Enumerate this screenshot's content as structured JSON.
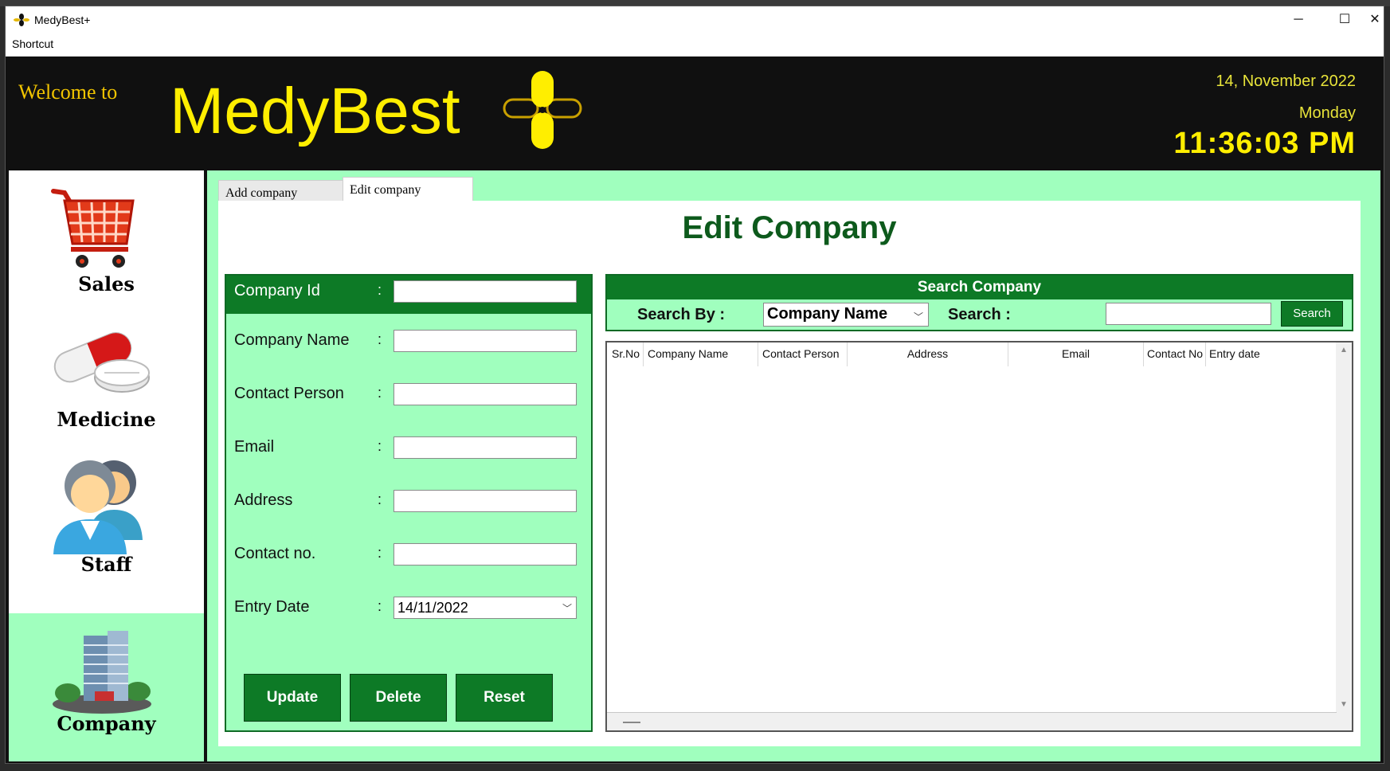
{
  "window": {
    "title": "MedyBest+",
    "minimize": "─",
    "maximize": "☐",
    "close": "✕"
  },
  "menu": {
    "shortcut": "Shortcut"
  },
  "header": {
    "welcome": "Welcome to",
    "brand": "MedyBest",
    "date": "14, November 2022",
    "day": "Monday",
    "time": "11:36:03 PM"
  },
  "sidebar": {
    "items": [
      {
        "label": "Sales",
        "icon": "shopping-cart-icon"
      },
      {
        "label": "Medicine",
        "icon": "pills-icon"
      },
      {
        "label": "Staff",
        "icon": "users-icon"
      },
      {
        "label": "Company",
        "icon": "building-icon"
      }
    ],
    "active": "Company"
  },
  "tabs": {
    "add": "Add company",
    "edit": "Edit company"
  },
  "page_title": "Edit Company",
  "form": {
    "company_id": "Company Id",
    "company_name": "Company Name",
    "contact_person": "Contact Person",
    "email": "Email",
    "address": "Address",
    "contact_no": "Contact no.",
    "entry_date": "Entry Date",
    "colon": ":",
    "entry_date_value": "14/11/2022",
    "update": "Update",
    "delete": "Delete",
    "reset": "Reset"
  },
  "search": {
    "header": "Search Company",
    "search_by_label": "Search By :",
    "search_by_value": "Company Name",
    "search_label": "Search :",
    "button": "Search"
  },
  "table": {
    "columns": [
      "Sr.No",
      "Company Name",
      "Contact Person",
      "Address",
      "Email",
      "Contact No",
      "Entry date"
    ]
  },
  "colors": {
    "accent_green": "#0d7a26",
    "mint": "#a0ffbe",
    "brand_yellow": "#ffee00",
    "header_bg": "#101010"
  }
}
